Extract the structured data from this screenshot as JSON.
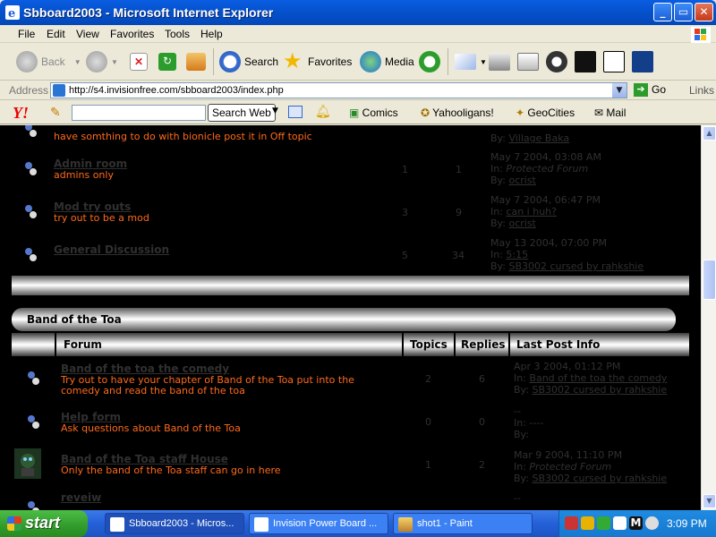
{
  "window": {
    "title": "Sbboard2003 - Microsoft Internet Explorer",
    "buttons": {
      "minimize": "_",
      "maximize": "▭",
      "close": "✕"
    }
  },
  "menu": [
    "File",
    "Edit",
    "View",
    "Favorites",
    "Tools",
    "Help"
  ],
  "toolbar": {
    "back": "Back",
    "search": "Search",
    "favorites": "Favorites",
    "media": "Media"
  },
  "address": {
    "label": "Address",
    "url": "http://s4.invisionfree.com/sbboard2003/index.php",
    "go": "Go",
    "links": "Links"
  },
  "yahoo": {
    "logo": "Y!",
    "search_button": "Search Web",
    "items": [
      "Comics",
      "Yahooligans!",
      "GeoCities",
      "Mail"
    ]
  },
  "top_forums": [
    {
      "desc": "have somthing to do with bionicle post it in Off topic",
      "lastpost_by": "Village Baka"
    },
    {
      "name": "Admin room",
      "desc": "admins only",
      "topics": "1",
      "replies": "1",
      "lastpost_date": "May 7 2004, 03:08 AM",
      "lastpost_in_label": "In:",
      "lastpost_in": "Protected Forum",
      "lastpost_by_label": "By:",
      "lastpost_by": "ocrist"
    },
    {
      "name": "Mod try outs",
      "desc": "try out to be a mod",
      "topics": "3",
      "replies": "9",
      "lastpost_date": "May 7 2004, 06:47 PM",
      "lastpost_in_label": "In:",
      "lastpost_in": "can i huh?",
      "lastpost_by_label": "By:",
      "lastpost_by": "ocrist"
    },
    {
      "name": "General Discussion",
      "desc": "",
      "topics": "5",
      "replies": "34",
      "lastpost_date": "May 13 2004, 07:00 PM",
      "lastpost_in_label": "In:",
      "lastpost_in": "5:15",
      "lastpost_by_label": "By:",
      "lastpost_by": "SB3002 cursed by rahkshie"
    }
  ],
  "category": {
    "title": "Band of the Toa",
    "headers": {
      "forum": "Forum",
      "topics": "Topics",
      "replies": "Replies",
      "lastpost": "Last Post Info"
    }
  },
  "forums": [
    {
      "name": "Band of the toa the comedy",
      "desc": "Try out to have your chapter of Band of the Toa put into the",
      "desc2": "comedy and read the band of the toa",
      "topics": "2",
      "replies": "6",
      "lastpost_date": "Apr 3 2004, 01:12 PM",
      "lastpost_in_label": "In:",
      "lastpost_in": "Band of the toa the comedy",
      "lastpost_by_label": "By:",
      "lastpost_by": "SB3002 cursed by rahkshie"
    },
    {
      "name": "Help form",
      "desc": "Ask questions about Band of the Toa",
      "topics": "0",
      "replies": "0",
      "lastpost_date": "--",
      "lastpost_in_label": "In:",
      "lastpost_in": "----",
      "lastpost_by_label": "By:",
      "lastpost_by": ""
    },
    {
      "name": "Band of the Toa staff House",
      "desc": "Only the band of the Toa staff can go in here",
      "topics": "1",
      "replies": "2",
      "lastpost_date": "Mar 9 2004, 11:10 PM",
      "lastpost_in_label": "In:",
      "lastpost_in": "Protected Forum",
      "lastpost_by_label": "By:",
      "lastpost_by": "SB3002 cursed by rahkshie"
    },
    {
      "name": "reveiw",
      "lastpost_date": "--"
    }
  ],
  "taskbar": {
    "start": "start",
    "tasks": [
      "Sbboard2003 - Micros...",
      "Invision Power Board ...",
      "shot1 - Paint"
    ],
    "clock": "3:09 PM"
  },
  "colors": {
    "accent_desc": "#ff6a1a",
    "titlebar": "#0553cf",
    "taskbar": "#2460d8"
  }
}
